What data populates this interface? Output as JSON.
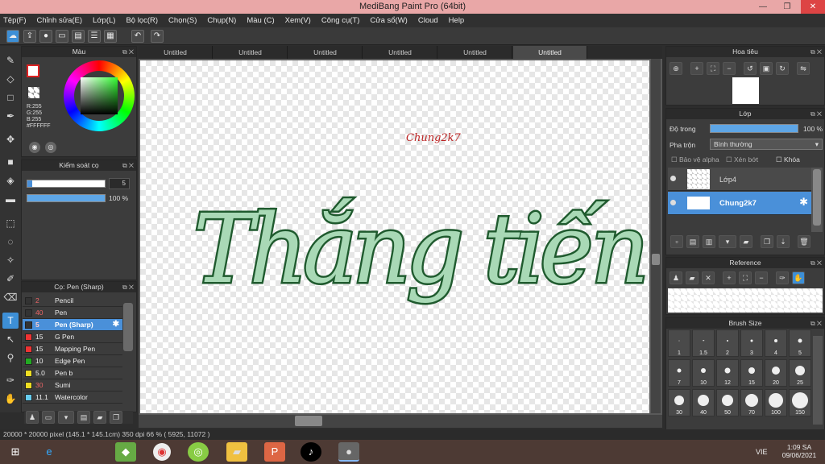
{
  "window": {
    "title": "MediBang Paint Pro (64bit)",
    "min": "—",
    "max": "❐",
    "close": "✕"
  },
  "menu": [
    "Tệp(F)",
    "Chỉnh sửa(E)",
    "Lớp(L)",
    "Bộ lọc(R)",
    "Chọn(S)",
    "Chụp(N)",
    "Màu (C)",
    "Xem(V)",
    "Công cụ(T)",
    "Cửa sổ(W)",
    "Cloud",
    "Help"
  ],
  "color_panel": {
    "title": "Màu",
    "r": "R:255",
    "g": "G:255",
    "b": "B:255",
    "hex": "#FFFFFF"
  },
  "brush_control": {
    "title": "Kiểm soát cọ",
    "size": "5",
    "opacity": "100 %"
  },
  "brush_panel": {
    "title": "Cọ: Pen (Sharp)",
    "brushes": [
      {
        "size": "2",
        "name": "Pencil",
        "color": "#333333"
      },
      {
        "size": "40",
        "name": "Pen",
        "color": "#333333"
      },
      {
        "size": "5",
        "name": "Pen (Sharp)",
        "color": "#333333"
      },
      {
        "size": "15",
        "name": "G Pen",
        "color": "#ee3333"
      },
      {
        "size": "15",
        "name": "Mapping Pen",
        "color": "#ee3333"
      },
      {
        "size": "10",
        "name": "Edge Pen",
        "color": "#22aa22"
      },
      {
        "size": "5.0",
        "name": "Pen b",
        "color": "#eedd22"
      },
      {
        "size": "30",
        "name": "Sumi",
        "color": "#eedd22"
      },
      {
        "size": "11.1",
        "name": "Watercolor",
        "color": "#66ccee"
      }
    ]
  },
  "tabs": [
    "Untitled",
    "Untitled",
    "Untitled",
    "Untitled",
    "Untitled",
    "Untitled"
  ],
  "canvas": {
    "signature": "Chung2k7",
    "artwork": "Thắng tiến"
  },
  "navigator": {
    "title": "Hoa tiêu"
  },
  "layers": {
    "title": "Lớp",
    "opacity_label": "Độ trong",
    "opacity_value": "100 %",
    "blend_label": "Pha trộn",
    "blend_value": "Bình thường",
    "protect_alpha": "Bảo vệ alpha",
    "clipping": "Xén bớt",
    "lock": "Khóa",
    "items": [
      {
        "name": "Lớp4"
      },
      {
        "name": "Chung2k7"
      }
    ]
  },
  "reference": {
    "title": "Reference"
  },
  "brush_size": {
    "title": "Brush Size",
    "sizes": [
      "1",
      "1.5",
      "2",
      "3",
      "4",
      "5",
      "7",
      "10",
      "12",
      "15",
      "20",
      "25",
      "30",
      "40",
      "50",
      "70",
      "100",
      "150"
    ]
  },
  "status": {
    "text": "20000 * 20000 pixel  (145.1 * 145.1cm)  350 dpi  66 %  ( 5925, 11072 )"
  },
  "taskbar": {
    "lang": "VIE",
    "time": "1:09 SA",
    "date": "09/06/2021"
  }
}
